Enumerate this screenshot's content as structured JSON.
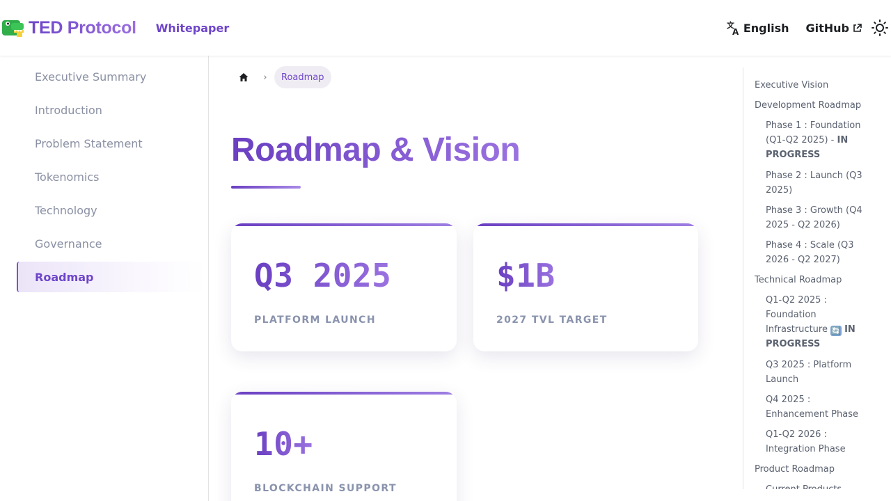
{
  "navbar": {
    "brand": "TED Protocol",
    "whitepaper_link": "Whitepaper",
    "language": "English",
    "github": "GitHub",
    "icons": {
      "logo": "crocodile-logo-icon",
      "language": "translate-icon",
      "external": "external-link-icon",
      "theme": "sun-icon"
    }
  },
  "sidebar": {
    "items": [
      {
        "label": "Executive Summary"
      },
      {
        "label": "Introduction"
      },
      {
        "label": "Problem Statement"
      },
      {
        "label": "Tokenomics"
      },
      {
        "label": "Technology"
      },
      {
        "label": "Governance"
      },
      {
        "label": "Roadmap",
        "active": true
      }
    ]
  },
  "breadcrumb": {
    "current": "Roadmap",
    "separator": "›"
  },
  "main": {
    "title": "Roadmap & Vision",
    "cards": [
      {
        "value": "Q3 2025",
        "label": "PLATFORM LAUNCH"
      },
      {
        "value": "$1B",
        "label": "2027 TVL TARGET"
      },
      {
        "value": "10+",
        "label": "BLOCKCHAIN SUPPORT"
      }
    ]
  },
  "toc": {
    "items": [
      {
        "text": "Executive Vision"
      },
      {
        "text": "Development Roadmap"
      },
      {
        "text": "Phase 1 : Foundation (Q1-Q2 2025) - ",
        "bold": "IN PROGRESS"
      },
      {
        "text": "Phase 2 : Launch (Q3 2025)"
      },
      {
        "text": "Phase 3 : Growth (Q4 2025 - Q2 2026)"
      },
      {
        "text": "Phase 4 : Scale (Q3 2026 - Q2 2027)"
      },
      {
        "text": "Technical Roadmap"
      },
      {
        "text": "Q1-Q2 2025 : Foundation Infrastructure ",
        "icon": "🔄",
        "bold": "IN PROGRESS"
      },
      {
        "text": "Q3 2025 : Platform Launch"
      },
      {
        "text": "Q4 2025 : Enhancement Phase"
      },
      {
        "text": "Q1-Q2 2026 : Integration Phase"
      },
      {
        "text": "Product Roadmap"
      },
      {
        "text": "Current Products"
      }
    ]
  },
  "colors": {
    "accent": "#6e45c9",
    "accent_light": "#9a72e0",
    "muted_text": "#8a90a3"
  }
}
